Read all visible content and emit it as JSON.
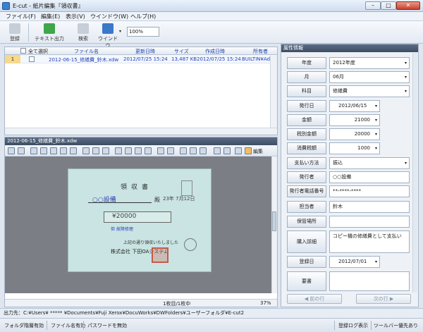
{
  "window": {
    "title": "E-cut - 紙片編集『領収書』",
    "min": "–",
    "max": "□",
    "close": "✕"
  },
  "menu": [
    "ファイル(F)",
    "編集(E)",
    "表示(V)",
    "ウインドウ(W)",
    "ヘルプ(H)"
  ],
  "toolbar": {
    "register": "登録",
    "text_export": "テキスト出力",
    "search": "検索",
    "window": "ウインドウ",
    "zoom": "100%"
  },
  "filelist": {
    "headers": {
      "select_all": "全て選択",
      "filename": "ファイル名",
      "updated": "更新日時",
      "size": "サイズ",
      "created": "作成日時",
      "owner": "所有者"
    },
    "row": {
      "num": "1",
      "filename": "2012-06-15_修繕費_鈴木.xdw",
      "updated": "2012/07/25 15:24",
      "size": "13,487 KB",
      "created": "2012/07/25 15:24",
      "owner": "BUILTIN¥Adm"
    }
  },
  "viewer": {
    "title": "2012-06-15_修繕費_鈴木.xdw",
    "edit_label": "編集",
    "pages": "1枚目/1枚中",
    "zoom": "37%",
    "receipt": {
      "title": "領収書",
      "to": "○○設備",
      "dono": "殿",
      "date": "23年 7月12日",
      "amount": "¥20000",
      "note": "但 故障修理",
      "note2": "上記の通り領収いたしました",
      "company": "株式会社 下田OAシステム"
    }
  },
  "props": {
    "title": "属性情報",
    "fields": [
      {
        "label": "年度",
        "value": "2012年度"
      },
      {
        "label": "月",
        "value": "06月"
      },
      {
        "label": "科目",
        "value": "修繕費"
      },
      {
        "label": "発行日",
        "value": "2012/06/15"
      },
      {
        "label": "金額",
        "value": "21000"
      },
      {
        "label": "税別金額",
        "value": "20000"
      },
      {
        "label": "消費税額",
        "value": "1000"
      },
      {
        "label": "支払い方法",
        "value": "振込"
      },
      {
        "label": "発行者",
        "value": "○○設備"
      },
      {
        "label": "発行者電話番号",
        "value": "**-****-****"
      },
      {
        "label": "担当者",
        "value": "鈴木"
      },
      {
        "label": "保管場所",
        "value": ""
      },
      {
        "label": "購入詳細",
        "value": "コピー機の修繕費として支払い"
      },
      {
        "label": "登録日",
        "value": "2012/07/01"
      },
      {
        "label": "要書",
        "value": ""
      }
    ],
    "prev": "前の行",
    "next": "次の行"
  },
  "output_path": "出力先：C:¥Users¥ ***** ¥Documents¥Fuji Xerox¥DocuWorks¥DWFolders¥ユーザーフォルダ¥E-cut2",
  "status": {
    "folder_layer": "フォルダ階層有効",
    "filename": "ファイル名有効",
    "password": "パスワードを無効",
    "login_display": "登録ログ表示",
    "toolbar_restore": "ツールバー優先あり"
  }
}
